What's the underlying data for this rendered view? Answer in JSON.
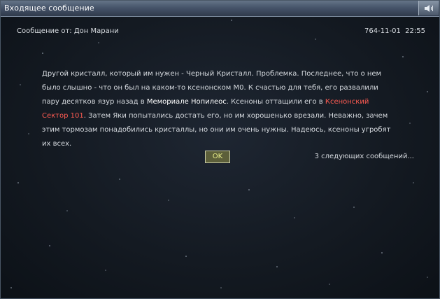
{
  "window": {
    "title": "Входящее сообщение"
  },
  "message": {
    "from": "Сообщение от: Дон Марани",
    "date": "764-11-01",
    "time": "22:55",
    "body": {
      "p1": "Другой кристалл, который им нужен - Черный Кристалл. Проблемка. Последнее, что о нем было слышно - что он был на каком-то ксенонском M0. К счастью для тебя, его развалили пару десятков язур назад в ",
      "place1": "Мемориале Нопилеос",
      "p2": ". Ксеноны оттащили его в ",
      "place2": "Ксенонский Сектор 101",
      "p3": ". Затем Яки попытались достать его, но им хорошенько врезали. Неважно, зачем этим тормозам понадобились кристаллы, но они им очень нужны. Надеюсь, ксеноны угробят их всех."
    }
  },
  "buttons": {
    "ok": "OK",
    "next": "3 следующих сообщений..."
  },
  "icons": {
    "sound": "speaker-icon"
  },
  "colors": {
    "highlight_place": "#ffffff",
    "highlight_sector": "#ff5b52",
    "ok_text": "#e9ee8a"
  }
}
